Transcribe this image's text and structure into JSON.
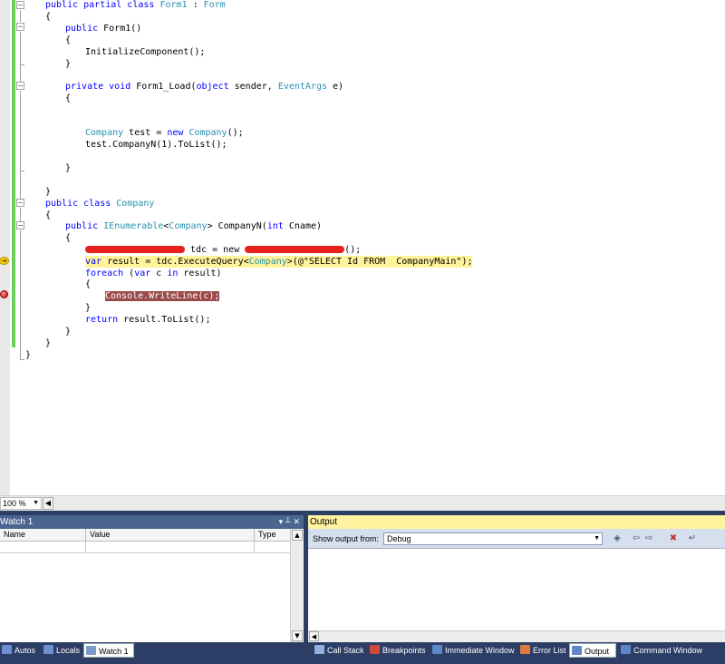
{
  "editor": {
    "lines": {
      "l1": "public partial class Form1 : Form",
      "l2": "{",
      "l3": "public Form1()",
      "l4": "{",
      "l5": "InitializeComponent();",
      "l6": "}",
      "l7": "private void Form1_Load(object sender, EventArgs e)",
      "l8": "{",
      "l9": "Company test = new Company();",
      "l10": "test.CompanyN(1).ToList();",
      "l11": "}",
      "l12": "}",
      "l13": "public class Company",
      "l14": "{",
      "l15": "public IEnumerable<Company> CompanyN(int Cname)",
      "l16": "{",
      "l17a": "tdc = new",
      "l17b": "();",
      "l18": "var result = tdc.ExecuteQuery<Company>(@\"SELECT Id FROM  CompanyMain\");",
      "l19": "foreach (var c in result)",
      "l20": "{",
      "l21": "Console.WriteLine(c);",
      "l22": "}",
      "l23": "return result.ToList();",
      "l24": "}",
      "l25": "}",
      "l26": "}"
    }
  },
  "zoom": {
    "level": "100 %"
  },
  "watch": {
    "title": "Watch 1",
    "pin": "▾ ┴ ✕",
    "columns": [
      "Name",
      "Value",
      "Type"
    ]
  },
  "output": {
    "title": "Output",
    "show_from_label": "Show output from:",
    "source": "Debug"
  },
  "tabs": {
    "left": [
      "Autos",
      "Locals",
      "Watch 1"
    ],
    "right": [
      "Call Stack",
      "Breakpoints",
      "Immediate Window",
      "Error List",
      "Output",
      "Command Window"
    ]
  },
  "colors": {
    "keyword": "#0000ff",
    "type": "#2b91af",
    "current_line_highlight": "#fff39b",
    "breakpoint_highlight": "#9b4a4a",
    "redaction": "#e8211f"
  }
}
